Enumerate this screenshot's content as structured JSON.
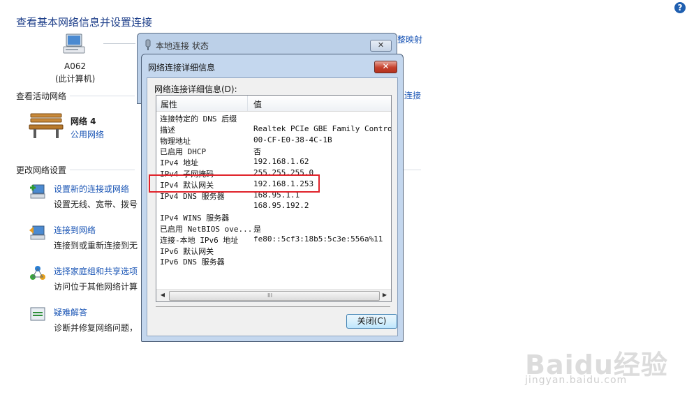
{
  "page": {
    "title": "查看基本网络信息并设置连接",
    "computer_name": "A062",
    "computer_sub": "(此计算机)",
    "active_networks": "查看活动网络",
    "network_name": "网络  4",
    "network_type": "公用网络",
    "right_link_1": "查看完整映射",
    "right_link_1_visible": "整映射",
    "right_link_2_visible": "连接",
    "change_settings": "更改网络设置",
    "tasks": [
      {
        "title": "设置新的连接或网络",
        "desc": "设置无线、宽带、拨号"
      },
      {
        "title": "连接到网络",
        "desc": "连接到或重新连接到无"
      },
      {
        "title": "选择家庭组和共享选项",
        "desc": "访问位于其他网络计算"
      },
      {
        "title": "疑难解答",
        "desc": "诊断并修复网络问题，"
      }
    ]
  },
  "back_dialog": {
    "title": "本地连接 状态",
    "close": "✕"
  },
  "dialog": {
    "title": "网络连接详细信息",
    "close": "✕",
    "caption": "网络连接详细信息(D):",
    "col_property": "属性",
    "col_value": "值",
    "rows": [
      {
        "p": "连接特定的 DNS 后缀",
        "v": ""
      },
      {
        "p": "描述",
        "v": "Realtek PCIe GBE Family Controller"
      },
      {
        "p": "物理地址",
        "v": "00-CF-E0-38-4C-1B"
      },
      {
        "p": "已启用 DHCP",
        "v": "否"
      },
      {
        "p": "IPv4 地址",
        "v": "192.168.1.62"
      },
      {
        "p": "IPv4 子网掩码",
        "v": "255.255.255.0"
      },
      {
        "p": "IPv4 默认网关",
        "v": "192.168.1.253"
      },
      {
        "p": "IPv4 DNS 服务器",
        "v": "168.95.1.1"
      },
      {
        "p": "",
        "v": "168.95.192.2"
      },
      {
        "p": "IPv4 WINS 服务器",
        "v": ""
      },
      {
        "p": "已启用 NetBIOS ove...",
        "v": "是"
      },
      {
        "p": "连接-本地 IPv6 地址",
        "v": "fe80::5cf3:18b5:5c3e:556a%11"
      },
      {
        "p": "IPv6 默认网关",
        "v": ""
      },
      {
        "p": "IPv6 DNS 服务器",
        "v": ""
      }
    ],
    "close_button": "关闭(C)",
    "scroll_left": "◀",
    "scroll_right": "▶",
    "scroll_grip": "III"
  },
  "help": "?",
  "watermark": {
    "brand": "Baidu经验",
    "url": "jingyan.baidu.com"
  }
}
